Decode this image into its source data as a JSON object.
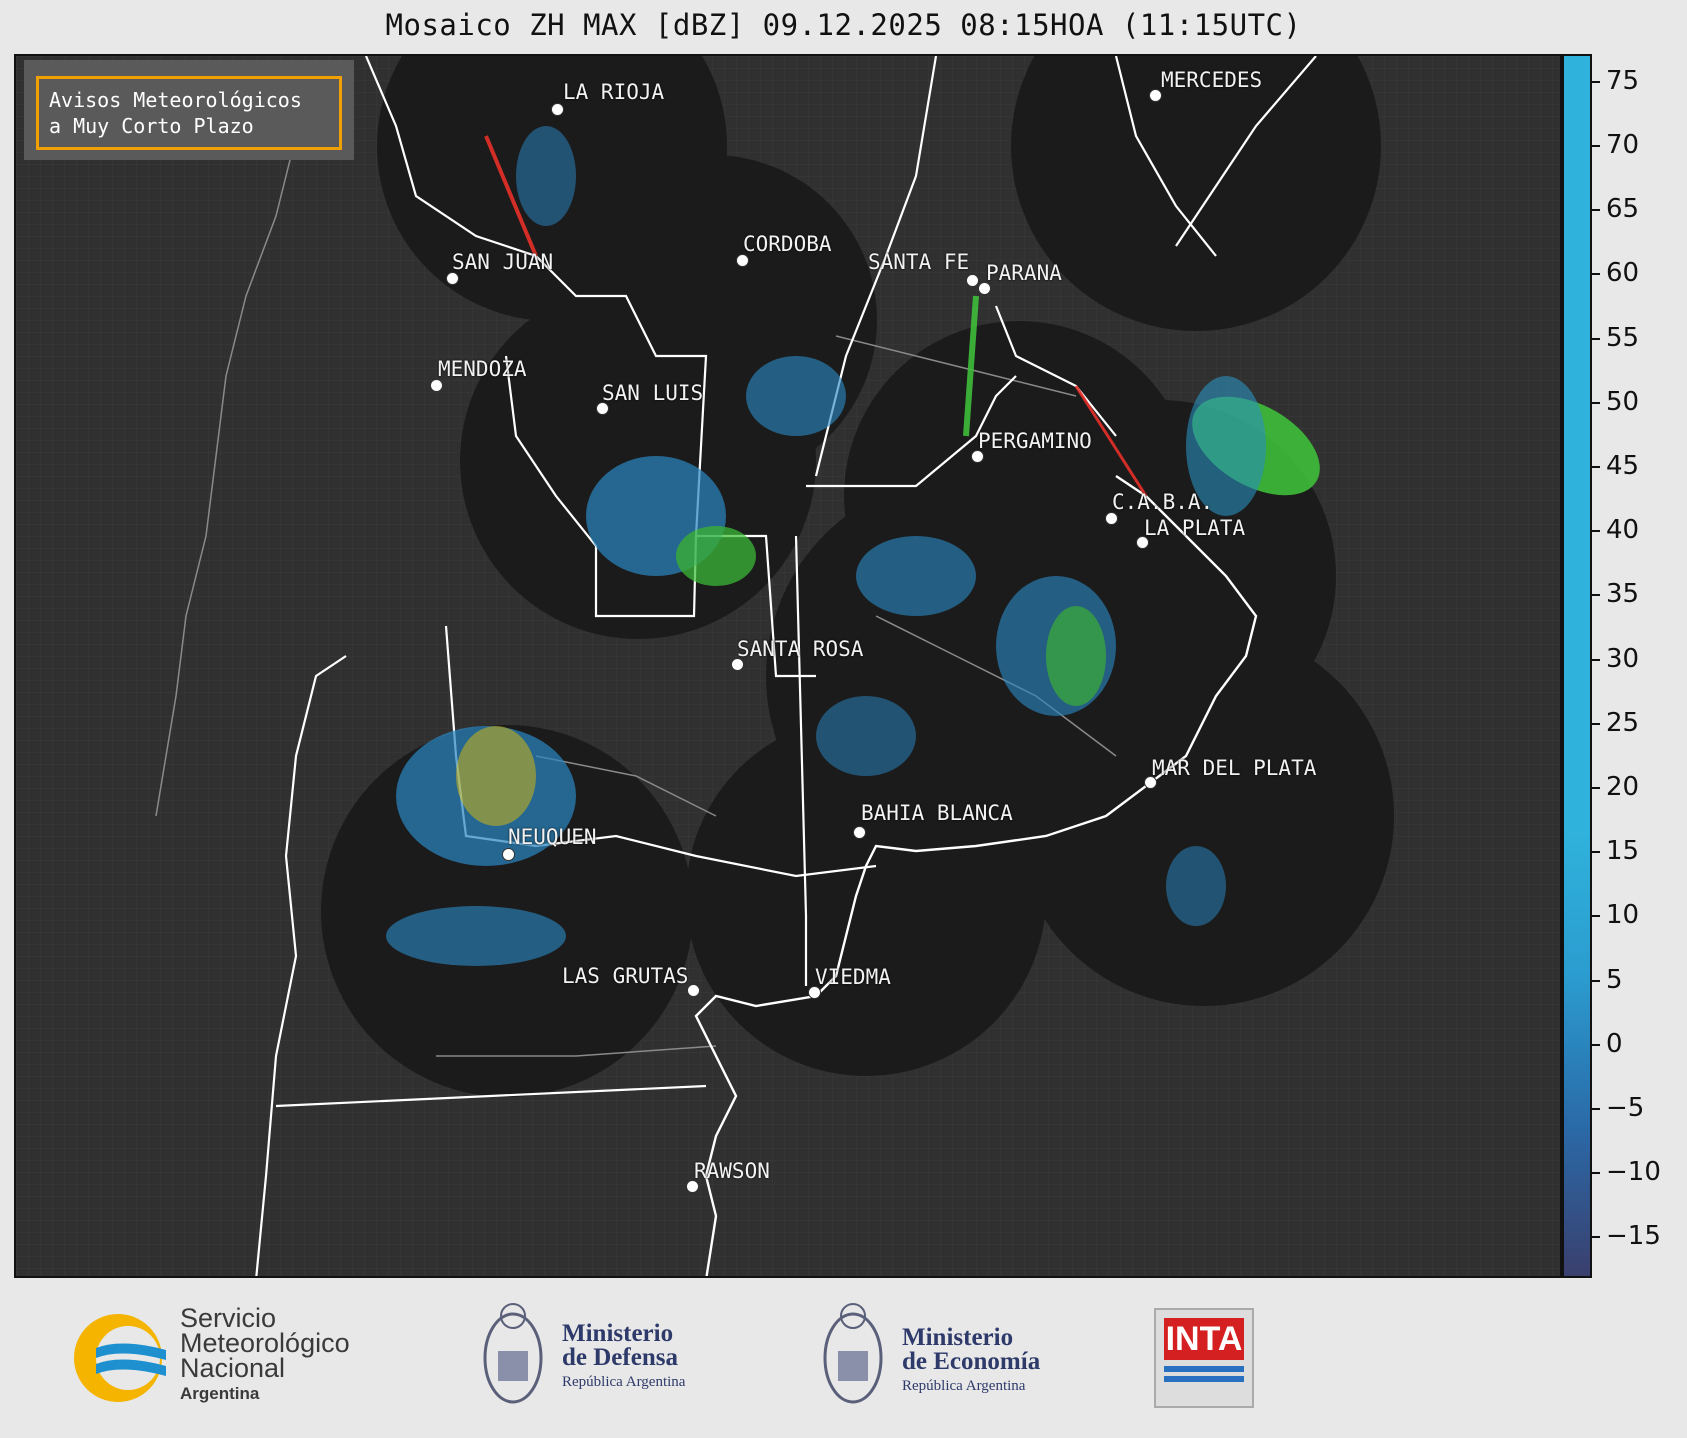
{
  "title": "Mosaico ZH MAX [dBZ] 09.12.2025 08:15HOA (11:15UTC)",
  "warning_box": {
    "line1": "Avisos Meteorológicos",
    "line2": "a Muy Corto Plazo",
    "border_color": "#f0a000"
  },
  "cities": [
    {
      "id": "la-rioja",
      "name": "LA RIOJA"
    },
    {
      "id": "mercedes",
      "name": "MERCEDES"
    },
    {
      "id": "cordoba",
      "name": "CORDOBA"
    },
    {
      "id": "san-juan",
      "name": "SAN JUAN"
    },
    {
      "id": "santa-fe",
      "name": "SANTA FE"
    },
    {
      "id": "parana",
      "name": "PARANA"
    },
    {
      "id": "mendoza",
      "name": "MENDOZA"
    },
    {
      "id": "san-luis",
      "name": "SAN LUIS"
    },
    {
      "id": "pergamino",
      "name": "PERGAMINO"
    },
    {
      "id": "caba",
      "name": "C.A.B.A."
    },
    {
      "id": "la-plata",
      "name": "LA PLATA"
    },
    {
      "id": "santa-rosa",
      "name": "SANTA ROSA"
    },
    {
      "id": "mar-del-plata",
      "name": "MAR DEL PLATA"
    },
    {
      "id": "bahia-blanca",
      "name": "BAHIA BLANCA"
    },
    {
      "id": "neuquen",
      "name": "NEUQUEN"
    },
    {
      "id": "las-grutas",
      "name": "LAS GRUTAS"
    },
    {
      "id": "viedma",
      "name": "VIEDMA"
    },
    {
      "id": "rawson",
      "name": "RAWSON"
    }
  ],
  "colorbar": {
    "ticks": [
      "75",
      "70",
      "65",
      "60",
      "55",
      "50",
      "45",
      "40",
      "35",
      "30",
      "25",
      "20",
      "15",
      "10",
      "5",
      "0",
      "−5",
      "−10",
      "−15"
    ],
    "min": -18,
    "max": 77,
    "stops": [
      {
        "from": -18,
        "to": 17,
        "gradient": [
          "#3a3f6e",
          "#2a6aa8",
          "#2b9ccf",
          "#2fb3dc"
        ]
      },
      {
        "from": 17,
        "to": 30,
        "gradient": [
          "#3fe03a",
          "#1f6e1f"
        ]
      },
      {
        "from": 30,
        "to": 40,
        "gradient": [
          "#f2ef3a",
          "#d6a21f",
          "#e0801a"
        ]
      },
      {
        "from": 40,
        "to": 50,
        "gradient": [
          "#e8302a",
          "#a80010"
        ]
      },
      {
        "from": 50,
        "to": 59,
        "gradient": [
          "#e0107a",
          "#f020d0",
          "#a000a0"
        ]
      },
      {
        "from": 59,
        "to": 61,
        "gradient": [
          "#ffffff",
          "#ffffff"
        ]
      },
      {
        "from": 61,
        "to": 77,
        "gradient": [
          "#d8f4ea",
          "#88dcc0"
        ]
      }
    ]
  },
  "logos": {
    "smn": {
      "line1": "Servicio",
      "line2": "Meteorológico",
      "line3": "Nacional",
      "line4": "Argentina"
    },
    "defensa": {
      "line1": "Ministerio",
      "line2": "de Defensa",
      "line3": "República Argentina"
    },
    "economia": {
      "line1": "Ministerio",
      "line2": "de Economía",
      "line3": "República Argentina"
    },
    "inta": {
      "text": "INTA"
    }
  }
}
